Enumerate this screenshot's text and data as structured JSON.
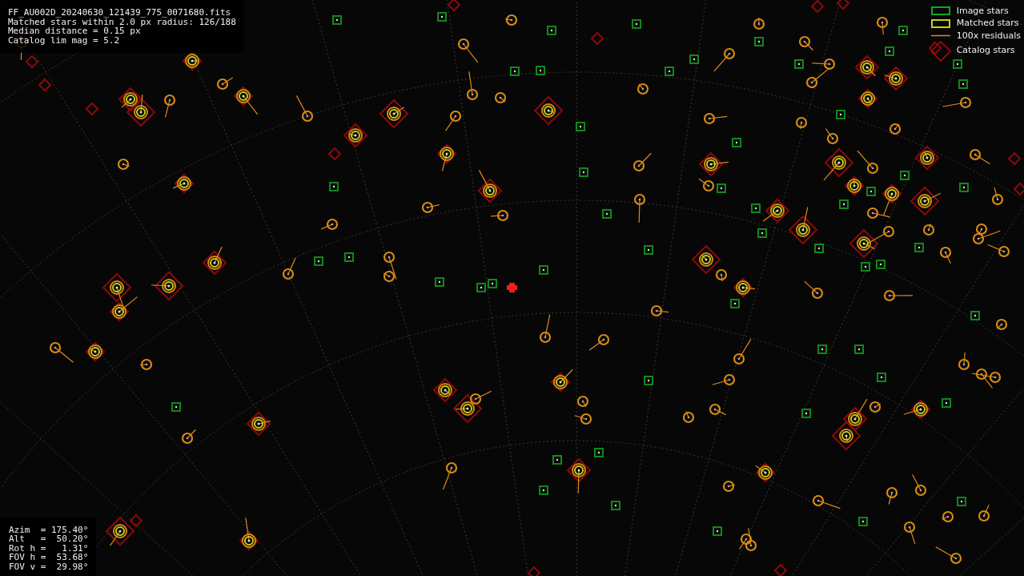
{
  "header": {
    "lines": [
      "FF_AU002D_20240630_121439_775_0071680.fits",
      "Matched stars within 2.0 px radius: 126/188",
      "Median distance = 0.15 px",
      "Catalog lim mag = 5.2"
    ]
  },
  "legend": {
    "items": [
      {
        "kind": "image",
        "label": "Image stars"
      },
      {
        "kind": "matched",
        "label": "Matched stars"
      },
      {
        "kind": "residual",
        "label": "100x residuals"
      },
      {
        "kind": "catalog",
        "label": "Catalog stars"
      }
    ]
  },
  "pointing": {
    "lines": [
      "Azim  = 175.40°",
      "Alt   =  50.20°",
      "Rot h =   1.31°",
      "FOV h =  53.68°",
      "FOV v =  29.98°"
    ]
  }
}
